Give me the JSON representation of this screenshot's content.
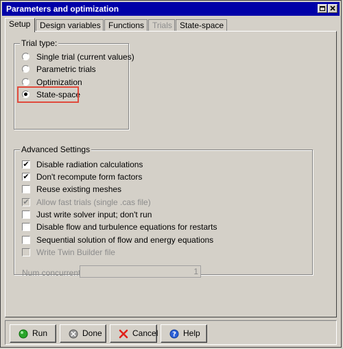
{
  "window": {
    "title": "Parameters and optimization"
  },
  "tabs": [
    {
      "label": "Setup",
      "state": "active"
    },
    {
      "label": "Design variables",
      "state": "normal"
    },
    {
      "label": "Functions",
      "state": "normal"
    },
    {
      "label": "Trials",
      "state": "disabled"
    },
    {
      "label": "State-space",
      "state": "normal"
    }
  ],
  "trial_type": {
    "legend": "Trial type:",
    "options": [
      {
        "label": "Single trial (current values)",
        "selected": false
      },
      {
        "label": "Parametric trials",
        "selected": false
      },
      {
        "label": "Optimization",
        "selected": false
      },
      {
        "label": "State-space",
        "selected": true
      }
    ]
  },
  "advanced": {
    "legend": "Advanced Settings",
    "options": [
      {
        "label": "Disable radiation calculations",
        "checked": true,
        "enabled": true
      },
      {
        "label": "Don't recompute form factors",
        "checked": true,
        "enabled": true
      },
      {
        "label": "Reuse existing meshes",
        "checked": false,
        "enabled": true
      },
      {
        "label": "Allow fast trials (single .cas file)",
        "checked": true,
        "enabled": false
      },
      {
        "label": "Just write solver input; don't run",
        "checked": false,
        "enabled": true
      },
      {
        "label": "Disable flow and turbulence equations for restarts",
        "checked": false,
        "enabled": true
      },
      {
        "label": "Sequential solution of flow and energy equations",
        "checked": false,
        "enabled": true
      },
      {
        "label": "Write Twin Builder file",
        "checked": false,
        "enabled": false
      }
    ],
    "num_concurrent_label": "Num concurrent",
    "num_concurrent_value": "1"
  },
  "buttons": {
    "run": "Run",
    "done": "Done",
    "cancel": "Cancel",
    "help": "Help"
  },
  "colors": {
    "titlebar": "#0000a8",
    "highlight": "#e04a3c",
    "face": "#d4d0c8"
  }
}
